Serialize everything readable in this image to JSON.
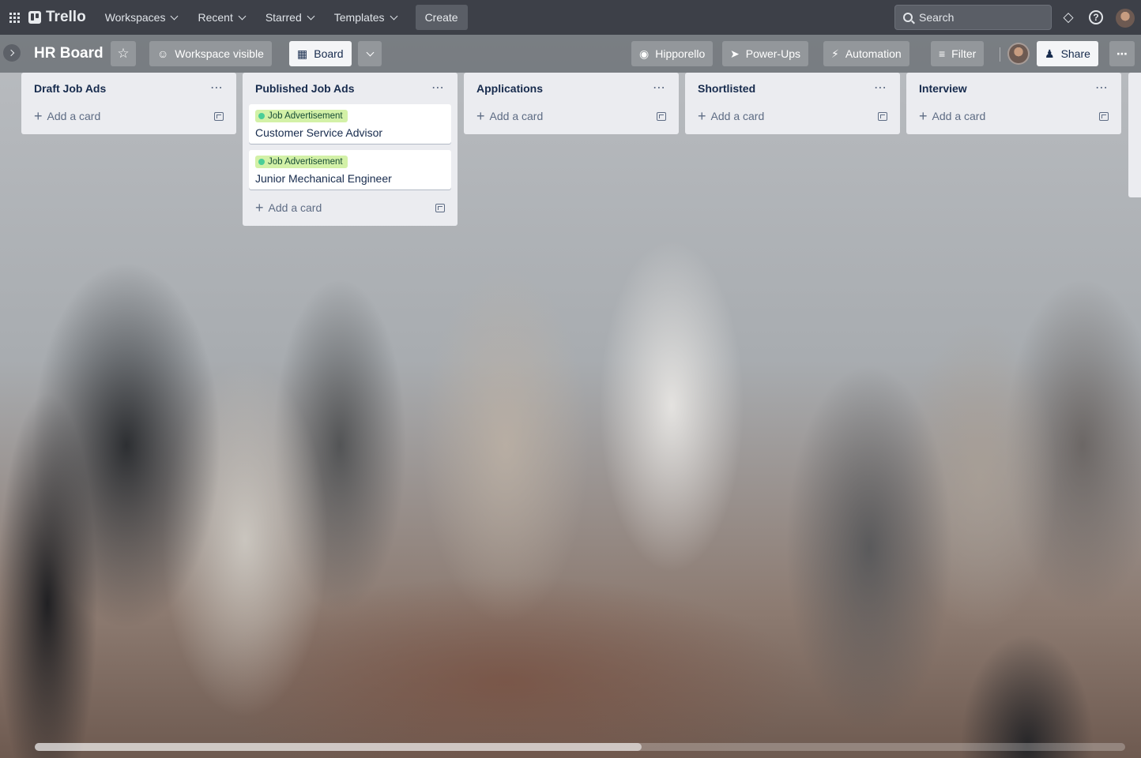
{
  "topnav": {
    "logo": "Trello",
    "items": [
      {
        "label": "Workspaces"
      },
      {
        "label": "Recent"
      },
      {
        "label": "Starred"
      },
      {
        "label": "Templates"
      }
    ],
    "create_label": "Create",
    "search_placeholder": "Search"
  },
  "board": {
    "title": "HR Board",
    "visibility_label": "Workspace visible",
    "view_label": "Board",
    "hipporello_label": "Hipporello",
    "powerups_label": "Power-Ups",
    "automation_label": "Automation",
    "filter_label": "Filter",
    "share_label": "Share"
  },
  "lists": [
    {
      "title": "Draft Job Ads",
      "cards": [],
      "add_label": "Add a card"
    },
    {
      "title": "Published Job Ads",
      "cards": [
        {
          "label": "Job Advertisement",
          "title": "Customer Service Advisor"
        },
        {
          "label": "Job Advertisement",
          "title": "Junior Mechanical Engineer"
        }
      ],
      "add_label": "Add a card"
    },
    {
      "title": "Applications",
      "cards": [],
      "add_label": "Add a card"
    },
    {
      "title": "Shortlisted",
      "cards": [],
      "add_label": "Add a card"
    },
    {
      "title": "Interview",
      "cards": [],
      "add_label": "Add a card"
    }
  ],
  "colors": {
    "topnav": "#3d4048",
    "list_bg": "#ebecf0",
    "label_green": "#d3f1a7",
    "label_dot": "#4bce97"
  },
  "icons": [
    "apps-grid-icon",
    "trello-logo-icon",
    "search-icon",
    "notification-icon",
    "help-icon",
    "star-icon",
    "people-icon",
    "board-icon",
    "chevron-down-icon",
    "power-ups-icon",
    "automation-icon",
    "filter-icon",
    "share-icon",
    "more-icon",
    "plus-icon",
    "template-icon"
  ]
}
